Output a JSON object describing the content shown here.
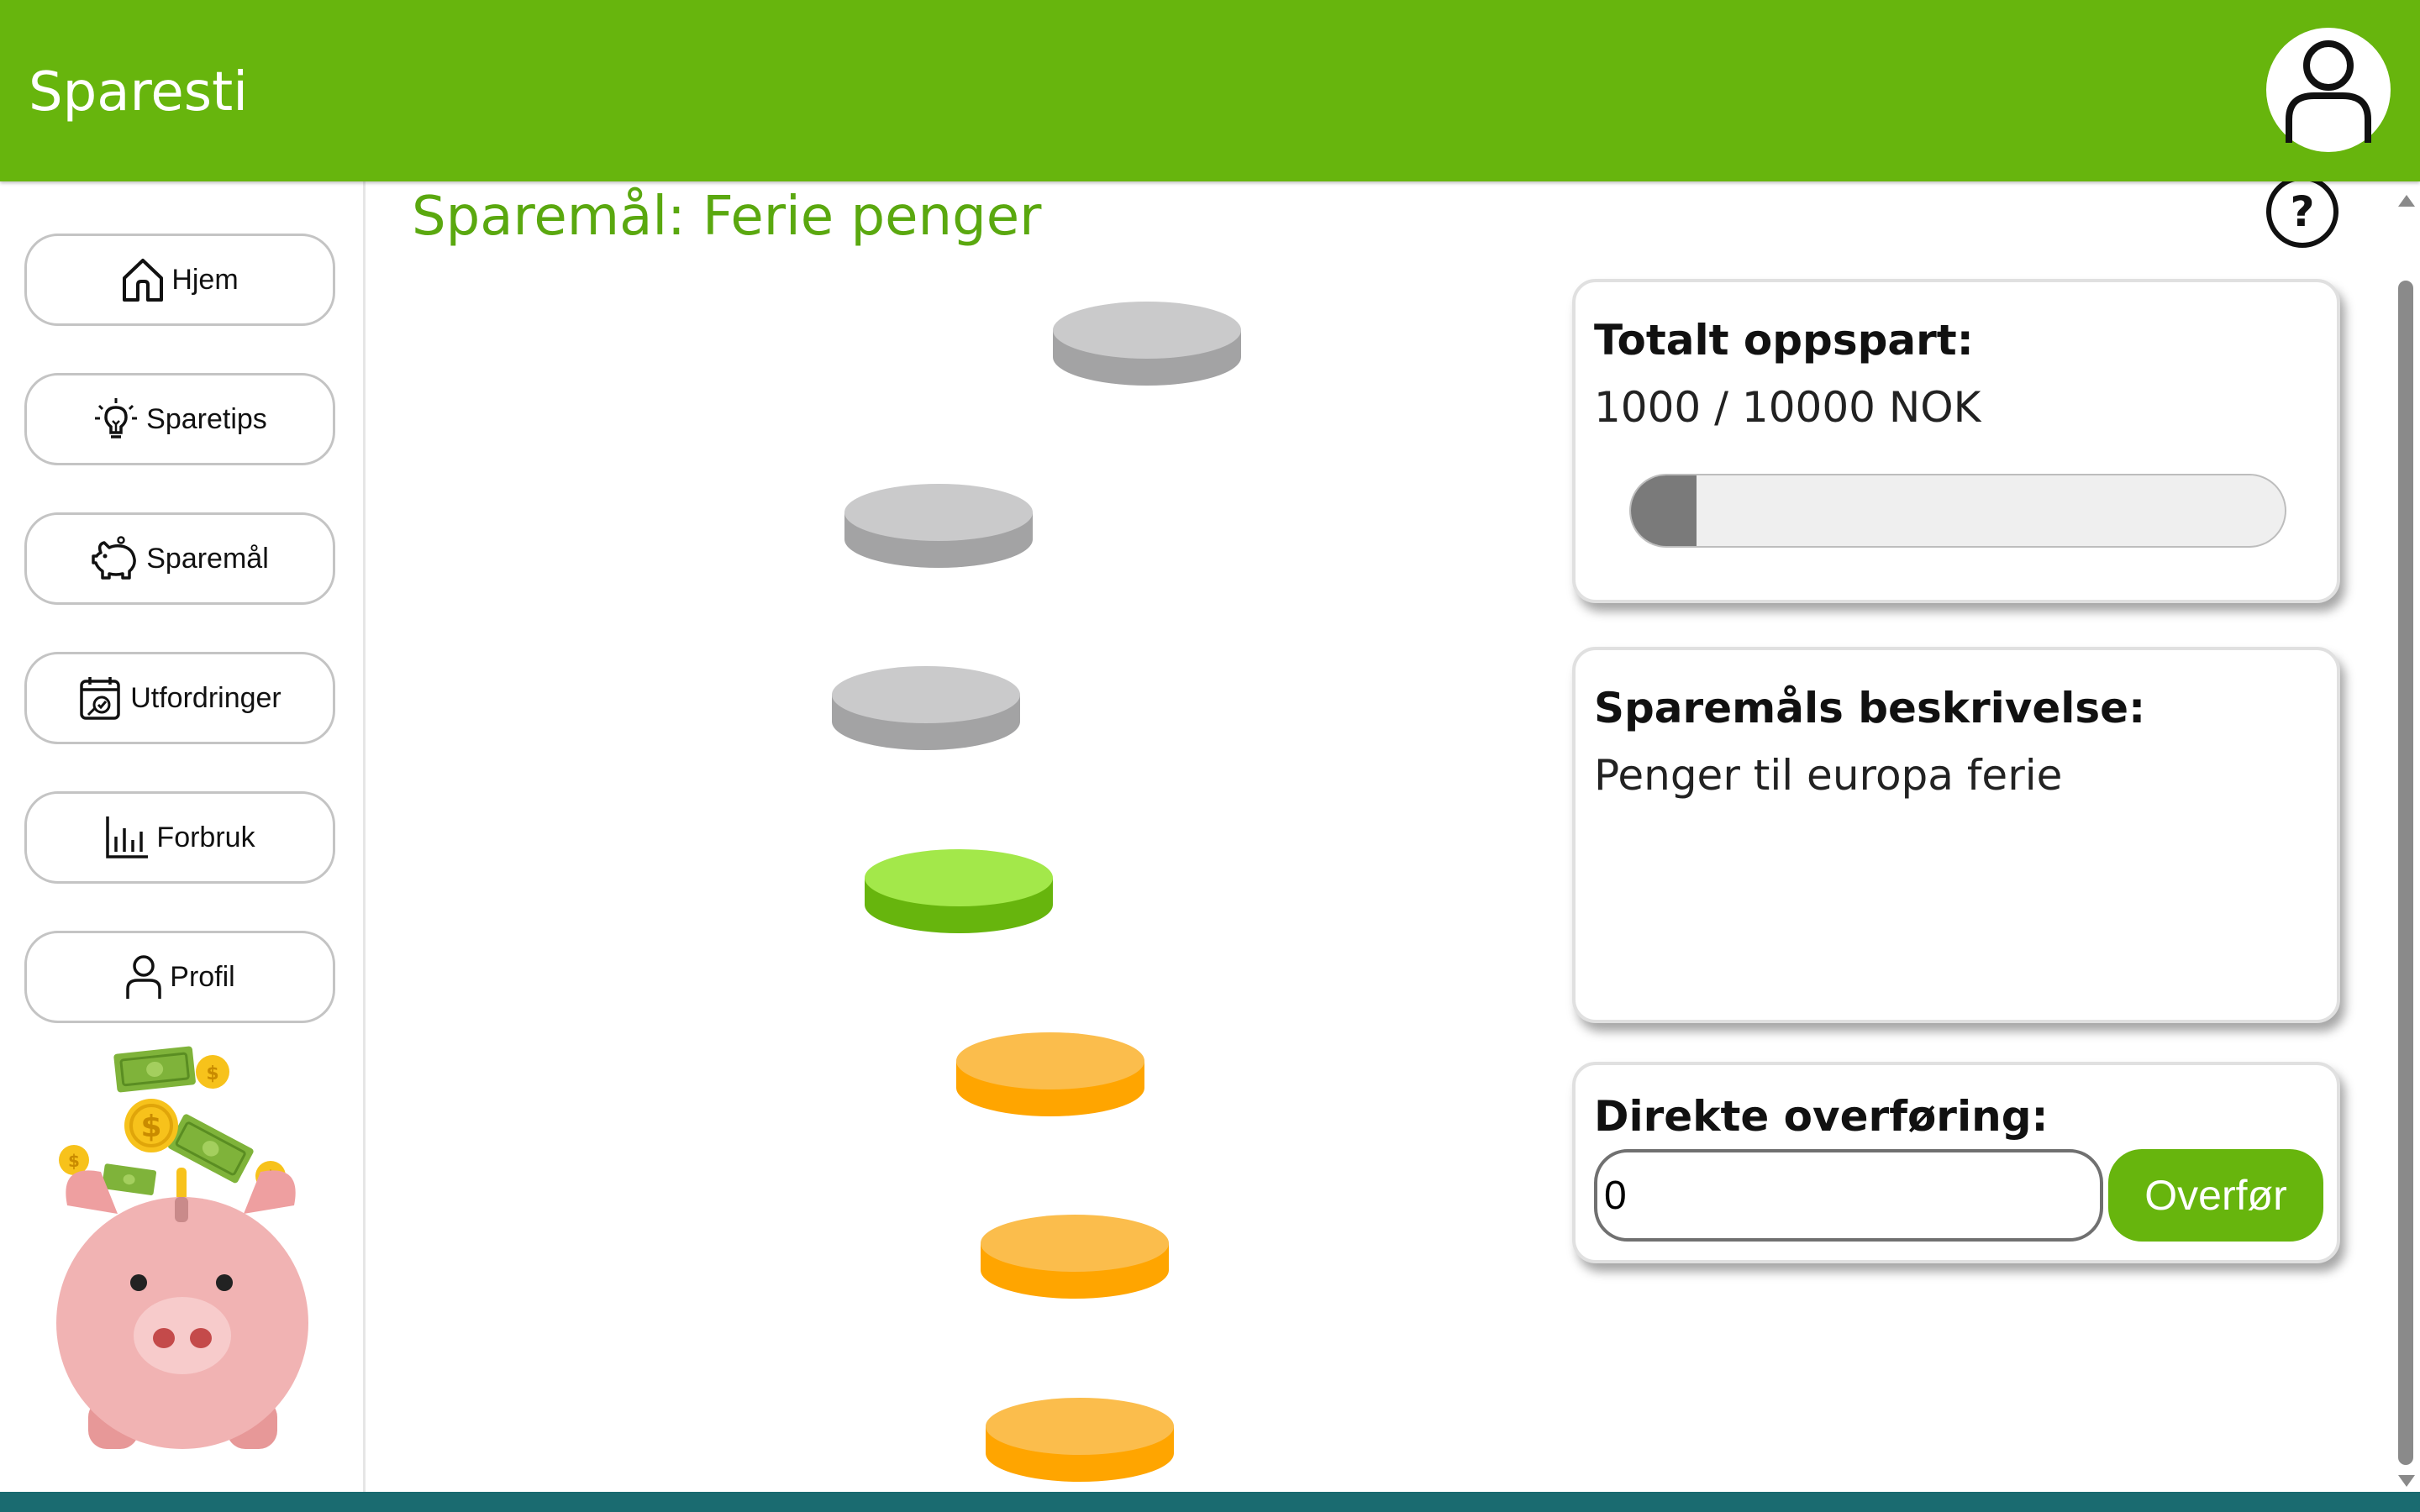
{
  "header": {
    "app_title": "Sparesti",
    "profile_icon": "user-icon",
    "brand_color": "#67b50d"
  },
  "sidebar": {
    "items": [
      {
        "label": "Hjem",
        "icon": "home-icon"
      },
      {
        "label": "Sparetips",
        "icon": "lightbulb-icon"
      },
      {
        "label": "Sparemål",
        "icon": "piggy-bank-icon"
      },
      {
        "label": "Utfordringer",
        "icon": "calendar-challenge-icon"
      },
      {
        "label": "Forbruk",
        "icon": "bar-chart-icon"
      },
      {
        "label": "Profil",
        "icon": "user-icon"
      }
    ],
    "illustration": "piggy-bank-with-money-illustration"
  },
  "main": {
    "goal_title": "Sparemål: Ferie penger",
    "help_icon": "help-icon",
    "coin_path": [
      {
        "state": "locked",
        "color": "#a3a3a4"
      },
      {
        "state": "locked",
        "color": "#a3a3a4"
      },
      {
        "state": "locked",
        "color": "#a3a3a4"
      },
      {
        "state": "current",
        "color": "#67b50d"
      },
      {
        "state": "completed",
        "color": "#ffa500"
      },
      {
        "state": "completed",
        "color": "#ffa500"
      },
      {
        "state": "completed",
        "color": "#ffa500"
      }
    ]
  },
  "savings_card": {
    "heading": "Totalt oppspart:",
    "amount_text": "1000 / 10000 NOK",
    "progress": 0.1
  },
  "description_card": {
    "heading": "Sparemåls beskrivelse:",
    "text": "Penger til europa ferie"
  },
  "transfer_card": {
    "heading": "Direkte overføring:",
    "input_value": "0",
    "button_label": "Overfør"
  }
}
